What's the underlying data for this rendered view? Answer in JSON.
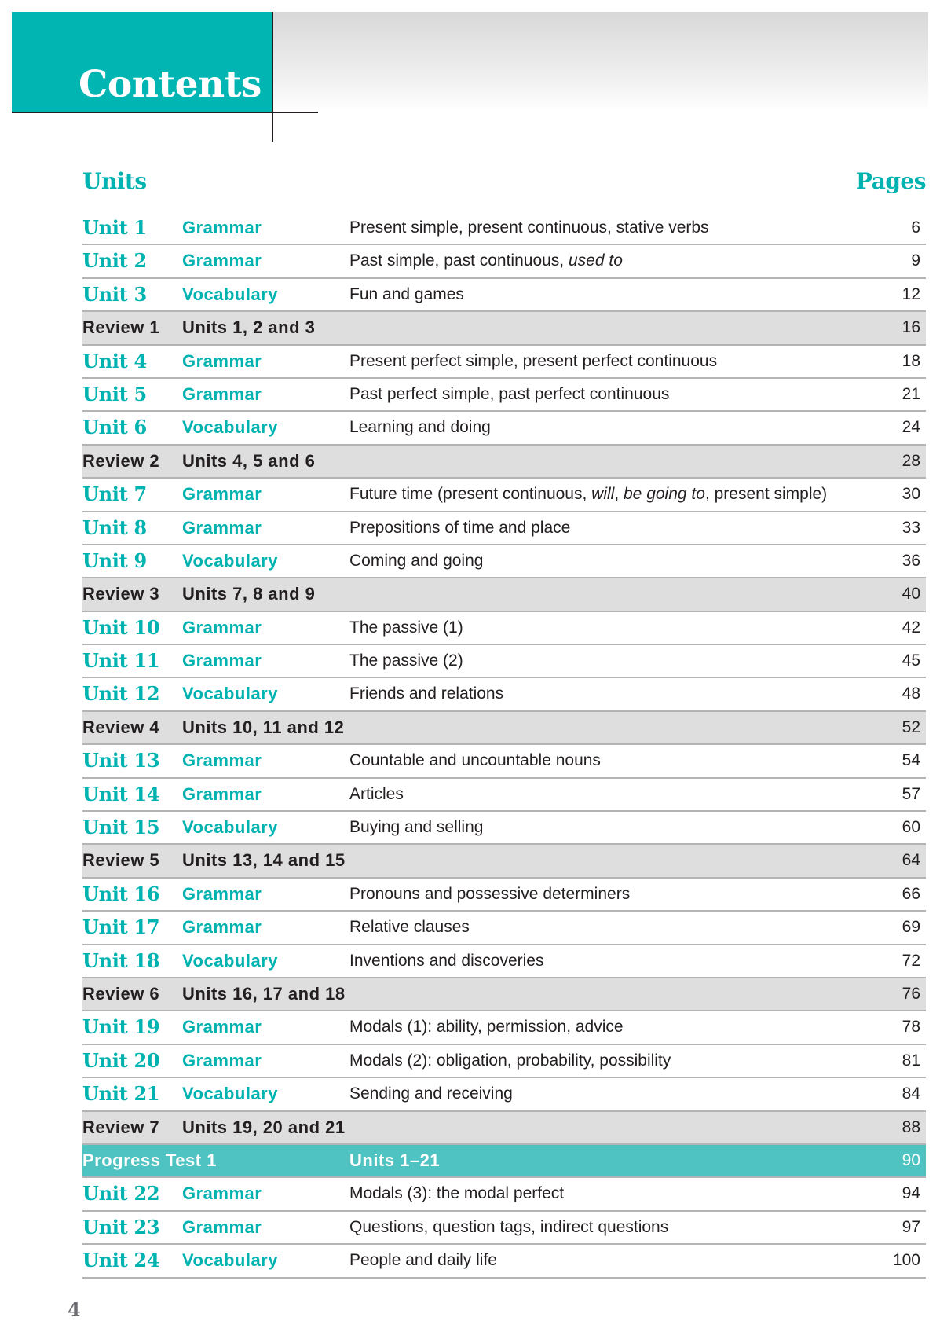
{
  "header": {
    "title": "Contents",
    "accent_color": "#00b5b2"
  },
  "columns": {
    "units": "Units",
    "pages": "Pages"
  },
  "rows": [
    {
      "kind": "unit",
      "unit": "Unit 1",
      "type": "Grammar",
      "desc": [
        {
          "t": "Present simple, present continuous, stative verbs"
        }
      ],
      "page": "6"
    },
    {
      "kind": "unit",
      "unit": "Unit 2",
      "type": "Grammar",
      "desc": [
        {
          "t": "Past simple, past continuous, "
        },
        {
          "t": "used to",
          "i": true
        }
      ],
      "page": "9"
    },
    {
      "kind": "unit",
      "unit": "Unit 3",
      "type": "Vocabulary",
      "desc": [
        {
          "t": "Fun and games"
        }
      ],
      "page": "12"
    },
    {
      "kind": "review",
      "unit": "Review 1",
      "type": "Units 1, 2 and 3",
      "desc": [],
      "page": "16"
    },
    {
      "kind": "unit",
      "unit": "Unit 4",
      "type": "Grammar",
      "desc": [
        {
          "t": "Present perfect simple, present perfect continuous"
        }
      ],
      "page": "18"
    },
    {
      "kind": "unit",
      "unit": "Unit 5",
      "type": "Grammar",
      "desc": [
        {
          "t": "Past perfect simple, past perfect continuous"
        }
      ],
      "page": "21"
    },
    {
      "kind": "unit",
      "unit": "Unit 6",
      "type": "Vocabulary",
      "desc": [
        {
          "t": "Learning and doing"
        }
      ],
      "page": "24"
    },
    {
      "kind": "review",
      "unit": "Review 2",
      "type": "Units 4, 5 and 6",
      "desc": [],
      "page": "28"
    },
    {
      "kind": "unit",
      "unit": "Unit 7",
      "type": "Grammar",
      "desc": [
        {
          "t": "Future time (present continuous, "
        },
        {
          "t": "will",
          "i": true
        },
        {
          "t": ", "
        },
        {
          "t": "be going to",
          "i": true
        },
        {
          "t": ", present simple)"
        }
      ],
      "page": "30"
    },
    {
      "kind": "unit",
      "unit": "Unit 8",
      "type": "Grammar",
      "desc": [
        {
          "t": "Prepositions of time and place"
        }
      ],
      "page": "33"
    },
    {
      "kind": "unit",
      "unit": "Unit 9",
      "type": "Vocabulary",
      "desc": [
        {
          "t": "Coming and going"
        }
      ],
      "page": "36"
    },
    {
      "kind": "review",
      "unit": "Review 3",
      "type": "Units 7, 8 and 9",
      "desc": [],
      "page": "40"
    },
    {
      "kind": "unit",
      "unit": "Unit 10",
      "type": "Grammar",
      "desc": [
        {
          "t": "The passive (1)"
        }
      ],
      "page": "42"
    },
    {
      "kind": "unit",
      "unit": "Unit 11",
      "type": "Grammar",
      "desc": [
        {
          "t": "The passive (2)"
        }
      ],
      "page": "45"
    },
    {
      "kind": "unit",
      "unit": "Unit 12",
      "type": "Vocabulary",
      "desc": [
        {
          "t": "Friends and relations"
        }
      ],
      "page": "48"
    },
    {
      "kind": "review",
      "unit": "Review 4",
      "type": "Units 10, 11 and 12",
      "desc": [],
      "page": "52"
    },
    {
      "kind": "unit",
      "unit": "Unit 13",
      "type": "Grammar",
      "desc": [
        {
          "t": "Countable and uncountable nouns"
        }
      ],
      "page": "54"
    },
    {
      "kind": "unit",
      "unit": "Unit 14",
      "type": "Grammar",
      "desc": [
        {
          "t": "Articles"
        }
      ],
      "page": "57"
    },
    {
      "kind": "unit",
      "unit": "Unit 15",
      "type": "Vocabulary",
      "desc": [
        {
          "t": "Buying and selling"
        }
      ],
      "page": "60"
    },
    {
      "kind": "review",
      "unit": "Review 5",
      "type": "Units 13, 14 and 15",
      "desc": [],
      "page": "64"
    },
    {
      "kind": "unit",
      "unit": "Unit 16",
      "type": "Grammar",
      "desc": [
        {
          "t": "Pronouns and possessive determiners"
        }
      ],
      "page": "66"
    },
    {
      "kind": "unit",
      "unit": "Unit 17",
      "type": "Grammar",
      "desc": [
        {
          "t": "Relative clauses"
        }
      ],
      "page": "69"
    },
    {
      "kind": "unit",
      "unit": "Unit 18",
      "type": "Vocabulary",
      "desc": [
        {
          "t": "Inventions and discoveries"
        }
      ],
      "page": "72"
    },
    {
      "kind": "review",
      "unit": "Review 6",
      "type": "Units 16, 17 and 18",
      "desc": [],
      "page": "76"
    },
    {
      "kind": "unit",
      "unit": "Unit 19",
      "type": "Grammar",
      "desc": [
        {
          "t": "Modals (1): ability, permission, advice"
        }
      ],
      "page": "78"
    },
    {
      "kind": "unit",
      "unit": "Unit 20",
      "type": "Grammar",
      "desc": [
        {
          "t": "Modals (2): obligation, probability, possibility"
        }
      ],
      "page": "81"
    },
    {
      "kind": "unit",
      "unit": "Unit 21",
      "type": "Vocabulary",
      "desc": [
        {
          "t": "Sending and receiving"
        }
      ],
      "page": "84"
    },
    {
      "kind": "review",
      "unit": "Review 7",
      "type": "Units 19, 20 and 21",
      "desc": [],
      "page": "88"
    },
    {
      "kind": "progress",
      "unit": "Progress Test 1",
      "type": "Units 1–21",
      "desc": [],
      "page": "90"
    },
    {
      "kind": "unit",
      "unit": "Unit 22",
      "type": "Grammar",
      "desc": [
        {
          "t": "Modals (3): the modal perfect"
        }
      ],
      "page": "94"
    },
    {
      "kind": "unit",
      "unit": "Unit 23",
      "type": "Grammar",
      "desc": [
        {
          "t": "Questions, question tags, indirect questions"
        }
      ],
      "page": "97"
    },
    {
      "kind": "unit",
      "unit": "Unit 24",
      "type": "Vocabulary",
      "desc": [
        {
          "t": "People and daily life"
        }
      ],
      "page": "100"
    }
  ],
  "footer": {
    "page_number": "4"
  }
}
